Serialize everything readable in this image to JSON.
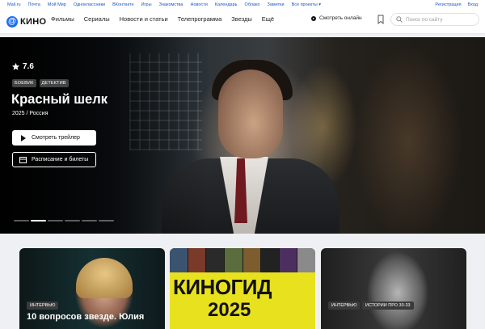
{
  "portal": {
    "links": [
      "Mail.ru",
      "Почта",
      "Мой Мир",
      "Одноклассники",
      "ВКонтакте",
      "Игры",
      "Знакомства",
      "Новости",
      "Календарь",
      "Облако",
      "Заметки",
      "Все проекты"
    ],
    "register": "Регистрация",
    "login": "Вход"
  },
  "nav": {
    "logo": "КИНО",
    "menu": [
      "Фильмы",
      "Сериалы",
      "Новости и статьи",
      "Телепрограмма",
      "Звезды",
      "Ещё"
    ],
    "watch_online": "Смотреть онлайн",
    "search_placeholder": "Поиск по сайту"
  },
  "hero": {
    "rating": "7.6",
    "tags": [
      "БОЕВИК",
      "ДЕТЕКТИВ"
    ],
    "title": "Красный шелк",
    "meta": "2025 / Россия",
    "trailer_button": "Смотреть трейлер",
    "schedule_button": "Расписание и билеты",
    "slides_count": 6,
    "active_slide": 2
  },
  "cards": [
    {
      "tags": [
        "ИНТЕРВЬЮ"
      ],
      "title": "10 вопросов звезде. Юлия"
    },
    {
      "headline_line1": "КИНОГИД",
      "headline_line2": "2025"
    },
    {
      "tags": [
        "ИНТЕРВЬЮ",
        "ИСТОРИИ ПРО 30-33"
      ]
    }
  ],
  "colors": {
    "accent": "#1d6ff2",
    "link": "#1a56c9",
    "poster_yellow": "#e8e11e"
  }
}
